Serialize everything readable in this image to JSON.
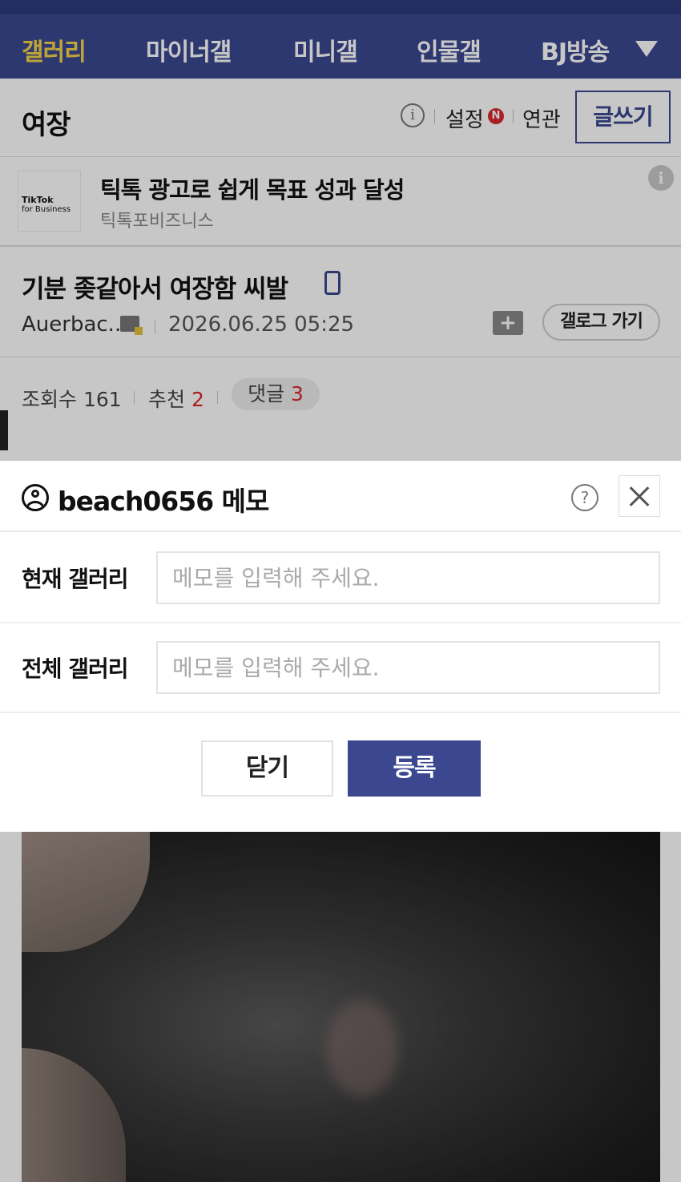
{
  "colors": {
    "nav_bg": "#3b4890",
    "active_nav": "#f3d34a",
    "accent_red": "#d9282f"
  },
  "nav": {
    "items": [
      "갤러리",
      "마이너갤",
      "미니갤",
      "인물갤",
      "BJ방송"
    ],
    "dropdown_icon": "triangle-down-icon"
  },
  "gallery": {
    "title": "여장",
    "info_label": "i",
    "settings_label": "설정",
    "settings_badge": "N",
    "related_label": "연관",
    "write_label": "글쓰기"
  },
  "ad": {
    "logo_line1": "TikTok",
    "logo_line2": "for Business",
    "title": "틱톡 광고로 쉽게 목표 성과 달성",
    "advertiser": "틱톡포비즈니스",
    "info_label": "i"
  },
  "post": {
    "title": "기분 좆같아서 여장함 씨발",
    "author": "Auerbac..",
    "date": "2026.06.25 05:25",
    "folder_plus": "+",
    "gallogue_button": "갤로그 가기"
  },
  "stats": {
    "views_label": "조회수",
    "views": "161",
    "recommend_label": "추천",
    "recommend": "2",
    "comments_label": "댓글",
    "comments": "3"
  },
  "memo": {
    "title": "beach0656 메모",
    "help_label": "?",
    "current_gallery_label": "현재 갤러리",
    "current_gallery_value": "",
    "all_gallery_label": "전체 갤러리",
    "all_gallery_value": "",
    "placeholder": "메모를 입력해 주세요.",
    "close_button": "닫기",
    "register_button": "등록"
  }
}
